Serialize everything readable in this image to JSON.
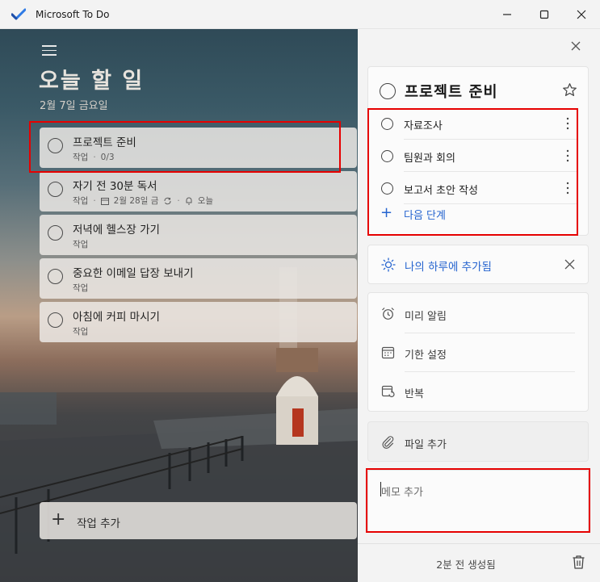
{
  "window": {
    "title": "Microsoft To Do"
  },
  "list": {
    "title": "오늘 할 일",
    "date": "2월 7일 금요일",
    "tasks": [
      {
        "title": "프로젝트 준비",
        "category": "작업",
        "progress": "0/3"
      },
      {
        "title": "자기 전 30분 독서",
        "category": "작업",
        "due": "2월 28일 금",
        "reminder": "오늘"
      },
      {
        "title": "저녁에 헬스장 가기",
        "category": "작업"
      },
      {
        "title": "중요한 이메일 답장 보내기",
        "category": "작업"
      },
      {
        "title": "아침에 커피 마시기",
        "category": "작업"
      }
    ],
    "add_task_label": "작업 추가"
  },
  "detail": {
    "task_title": "프로젝트 준비",
    "steps": [
      {
        "label": "자료조사"
      },
      {
        "label": "팀원과 회의"
      },
      {
        "label": "보고서 초안 작성"
      }
    ],
    "next_step_label": "다음 단계",
    "my_day_label": "나의 하루에 추가됨",
    "options": [
      {
        "label": "미리 알림",
        "icon": "alarm-icon"
      },
      {
        "label": "기한 설정",
        "icon": "calendar-icon"
      },
      {
        "label": "반복",
        "icon": "repeat-icon"
      }
    ],
    "add_file_label": "파일 추가",
    "memo_placeholder": "메모 추가",
    "created_text": "2분 전 생성됨"
  },
  "colors": {
    "accent": "#2564cf",
    "highlight": "#e60000"
  }
}
